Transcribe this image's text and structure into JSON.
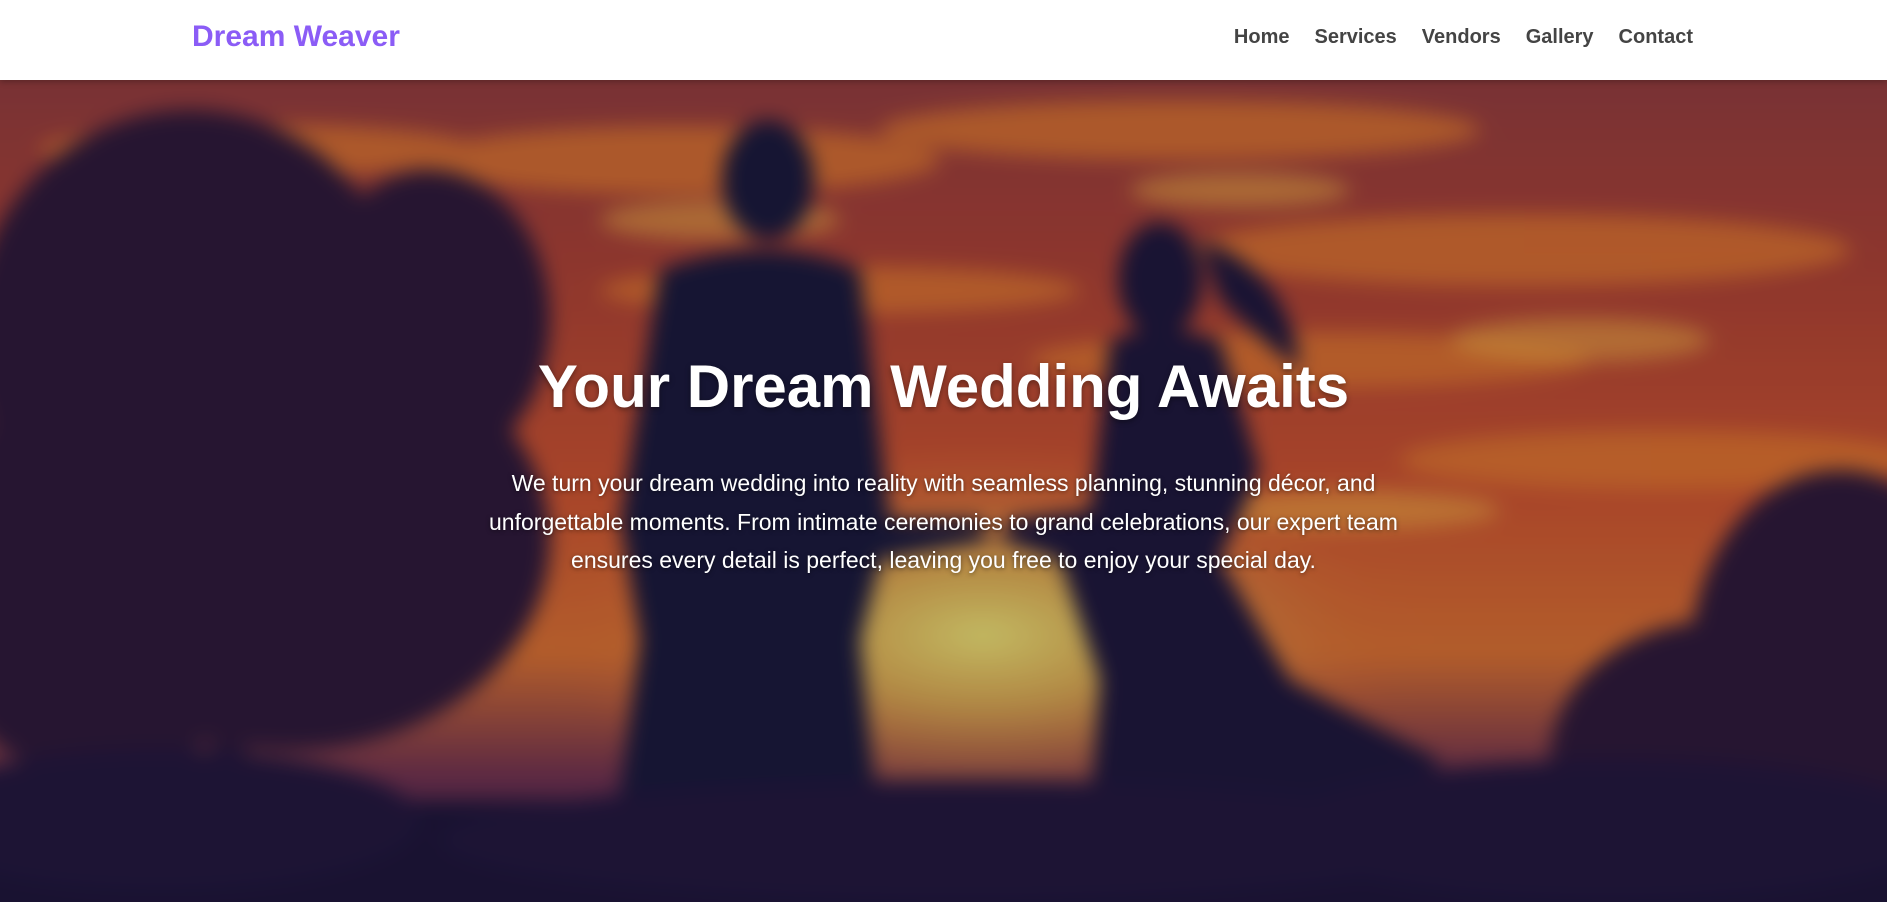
{
  "brand": {
    "name": "Dream Weaver",
    "color": "#8b5cf6"
  },
  "nav": {
    "links": [
      {
        "label": "Home"
      },
      {
        "label": "Services"
      },
      {
        "label": "Vendors"
      },
      {
        "label": "Gallery"
      },
      {
        "label": "Contact"
      }
    ]
  },
  "hero": {
    "title": "Your Dream Wedding Awaits",
    "description": "We turn your dream wedding into reality with seamless planning, stunning décor, and unforgettable moments. From intimate ceremonies to grand celebrations, our expert team ensures every detail is perfect, leaving you free to enjoy your special day.",
    "background_image": "blurred sunset silhouette of a couple holding hands among trees and tall grass"
  }
}
